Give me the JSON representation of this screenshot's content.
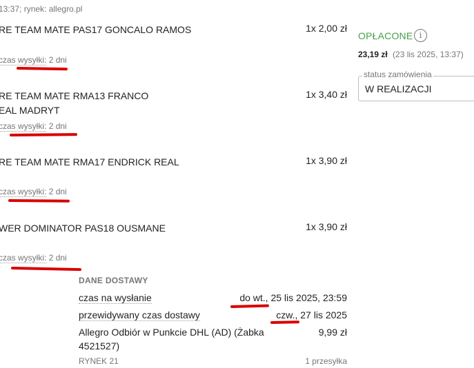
{
  "order_meta": "13:37; rynek: allegro.pl",
  "items": [
    {
      "name_line1": "RE TEAM MATE PAS17 GONCALO RAMOS",
      "name_line2": "",
      "qty_price": "1x 2,00 zł",
      "shipping_label": "czas wysyłki:",
      "shipping_value": "2 dni"
    },
    {
      "name_line1": "RE TEAM MATE RMA13 FRANCO",
      "name_line2": "EAL MADRYT",
      "qty_price": "1x 3,40 zł",
      "shipping_label": "czas wysyłki:",
      "shipping_value": "2 dni"
    },
    {
      "name_line1": "RE TEAM MATE RMA17 ENDRICK REAL",
      "name_line2": "",
      "qty_price": "1x 3,90 zł",
      "shipping_label": "czas wysyłki:",
      "shipping_value": "2 dni"
    },
    {
      "name_line1": "WER DOMINATOR PAS18 OUSMANE",
      "name_line2": "",
      "qty_price": "1x 3,90 zł",
      "shipping_label": "czas wysyłki:",
      "shipping_value": "2 dni"
    }
  ],
  "payment": {
    "status": "OPŁACONE",
    "info_icon": "info-icon",
    "amount": "23,19 zł",
    "date": "(23 lis 2025, 13:37)"
  },
  "order_status": {
    "legend": "status zamówienia",
    "value": "W REALIZACJI"
  },
  "delivery": {
    "title": "DANE DOSTAWY",
    "send_label": "czas na wysłanie",
    "send_value": "do wt., 25 lis 2025, 23:59",
    "eta_label": "przewidywany czas dostawy",
    "eta_value": "czw., 27 lis 2025",
    "method_line1": "Allegro Odbiór w Punkcie DHL (AD) (Żabka",
    "method_line2": "4521527)",
    "method_price": "9,99 zł",
    "market": "RYNEK 21",
    "shipments": "1 przesyłka"
  },
  "colors": {
    "paid_green": "#43a047",
    "annotation_red": "#d90000",
    "muted_grey": "#767676"
  }
}
